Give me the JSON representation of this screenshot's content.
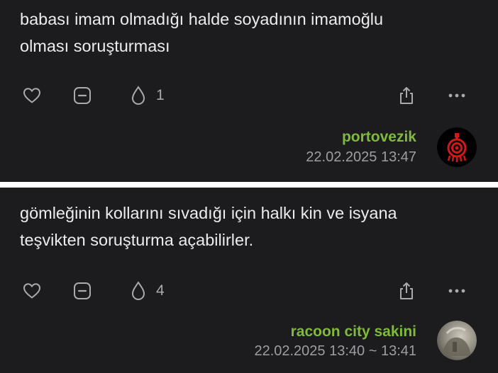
{
  "posts": [
    {
      "text_line1": "babası imam olmadığı halde soyadının imamoğlu",
      "text_line2": "olması soruşturması",
      "drops": "1",
      "author": "portovezik",
      "timestamp": "22.02.2025 13:47",
      "avatar_icon": "red-target-eye-icon"
    },
    {
      "text_line1": "gömleğinin kollarını sıvadığı için halkı kin ve isyana",
      "text_line2": "teşvikten soruşturma açabilirler.",
      "drops": "4",
      "author": "racoon city sakini",
      "timestamp": "22.02.2025 13:40 ~ 13:41",
      "avatar_icon": "photo-avatar"
    }
  ],
  "colors": {
    "background": "#1c1c1e",
    "author_name": "#7fba3c",
    "separator": "#ffffff"
  }
}
